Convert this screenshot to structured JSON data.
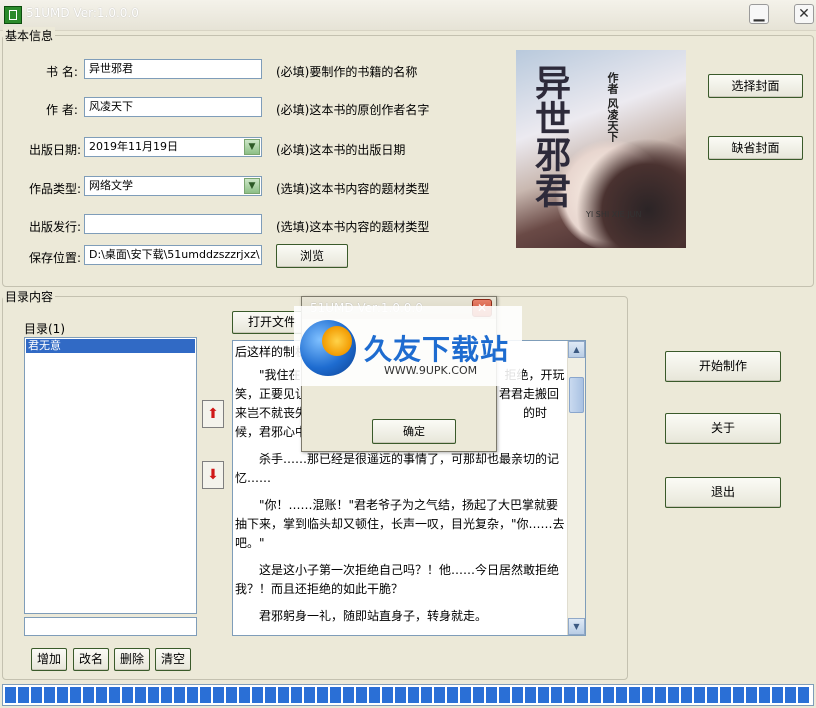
{
  "window": {
    "title": "51UMD Ver:1.0.0.0"
  },
  "basic_info": {
    "group_label": "基本信息",
    "fields": [
      {
        "label": "书  名:",
        "value": "异世邪君",
        "hint": "(必填)要制作的书籍的名称"
      },
      {
        "label": "作  者:",
        "value": "风凌天下",
        "hint": "(必填)这本书的原创作者名字"
      },
      {
        "label": "出版日期:",
        "value": "2019年11月19日",
        "hint": "(必填)这本书的出版日期"
      },
      {
        "label": "作品类型:",
        "value": "网络文学",
        "hint": "(选填)这本书内容的题材类型"
      },
      {
        "label": "出版发行:",
        "value": "",
        "hint": "(选填)这本书内容的题材类型"
      },
      {
        "label": "保存位置:",
        "value": "D:\\桌面\\安下载\\51umddzszzrjxz\\"
      }
    ],
    "browse_label": "浏览",
    "choose_cover_label": "选择封面",
    "default_cover_label": "缺省封面",
    "cover": {
      "title": "异世邪君",
      "author": "作者 风凌天下",
      "pinyin": "YI SHI XIE JUN"
    }
  },
  "contents": {
    "group_label": "目录内容",
    "list_label": "目录(1)",
    "list_items": [
      "君无意"
    ],
    "open_file_label": "打开文件",
    "buttons": [
      "增加",
      "改名",
      "删除",
      "清空"
    ],
    "text_paragraphs": [
      "后这样的制机.9UPK.COM",
      "　　\"我住在　　　　　　　　　　　　　　　　　拒绝，开玩笑，正要见让　　　　　　　　　　　　　　　　君君走搬回来岂不就丧失了　　　　　　　　　　　　　　　　　的时候，君邪心中就有些隐",
      "　　杀手……那已经是很遥远的事情了，可那却也最亲切的记忆……",
      "　　\"你！……混账！\"君老爷子为之气结，扬起了大巴掌就要抽下来，掌到临头却又顿住，长声一叹，目光复杂，\"你……去吧。\"",
      "　　这是这小子第一次拒绝自己吗？！他……今日居然敢拒绝我？！而且还拒绝的如此干脆？",
      "　　君邪躬身一礼，随即站直身子，转身就走。"
    ]
  },
  "actions": {
    "start": "开始制作",
    "about": "关于",
    "exit": "退出"
  },
  "dialog": {
    "title": "51UMD Ver:1.0.0.0",
    "ok": "确定"
  },
  "watermark": {
    "name": "久友下载站",
    "url": "WWW.9UPK.COM"
  },
  "progress": {
    "fraction": 1.0
  },
  "colors": {
    "face": "#ECE9D8",
    "selection": "#316ac5",
    "progress": "#2a6fd6",
    "arrow_red": "#d01818"
  }
}
